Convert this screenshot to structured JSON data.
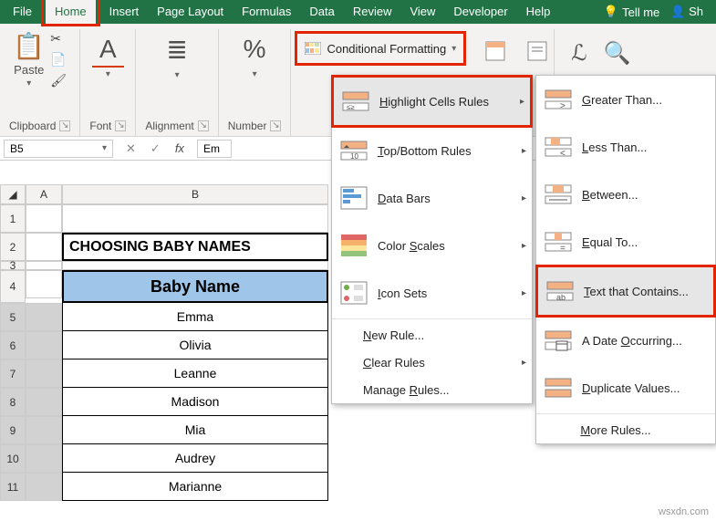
{
  "tabs": {
    "file": "File",
    "home": "Home",
    "insert": "Insert",
    "page_layout": "Page Layout",
    "formulas": "Formulas",
    "data": "Data",
    "review": "Review",
    "view": "View",
    "developer": "Developer",
    "help": "Help",
    "tell_me": "Tell me",
    "user": "Sh"
  },
  "ribbon": {
    "paste": "Paste",
    "clipboard": "Clipboard",
    "font": "Font",
    "alignment": "Alignment",
    "number": "Number",
    "cond_fmt": "Conditional Formatting"
  },
  "fxbar": {
    "namebox": "B5",
    "fx": "fx",
    "value": "Em"
  },
  "sheet": {
    "col_a": "A",
    "col_b": "B",
    "title": "CHOOSING BABY NAMES",
    "header": "Baby Name",
    "names": [
      "Emma",
      "Olivia",
      "Leanne",
      "Madison",
      "Mia",
      "Audrey",
      "Marianne"
    ]
  },
  "menu1": {
    "highlight": "Highlight Cells Rules",
    "topbottom": "Top/Bottom Rules",
    "databars": "Data Bars",
    "colorscales": "Color Scales",
    "iconsets": "Icon Sets",
    "newrule": "New Rule...",
    "clearrules": "Clear Rules",
    "managerules": "Manage Rules..."
  },
  "menu2": {
    "greater": "Greater Than...",
    "less": "Less Than...",
    "between": "Between...",
    "equal": "Equal To...",
    "text": "Text that Contains...",
    "date": "A Date Occurring...",
    "dup": "Duplicate Values...",
    "more": "More Rules..."
  },
  "watermark": "wsxdn.com"
}
